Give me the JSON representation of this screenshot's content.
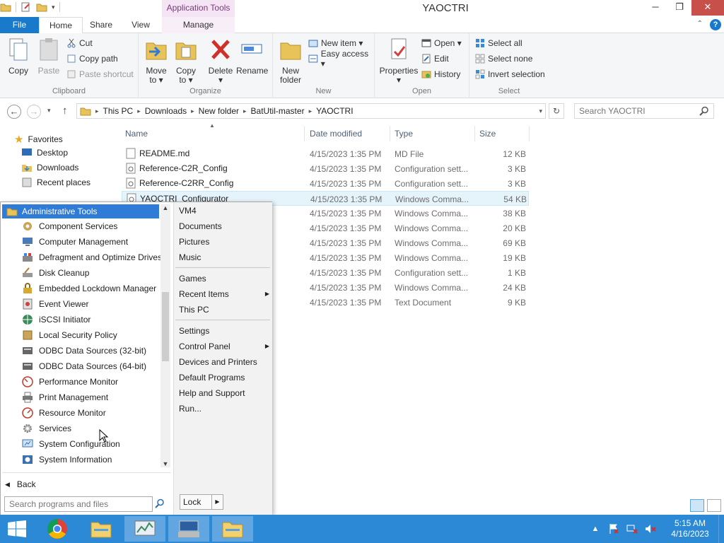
{
  "window": {
    "title": "YAOCTRI",
    "context_tab_title": "Application Tools",
    "controls": {
      "minimize": "─",
      "maximize": "❐",
      "close": "✕"
    }
  },
  "ribbon": {
    "tabs": {
      "file": "File",
      "home": "Home",
      "share": "Share",
      "view": "View",
      "manage": "Manage"
    },
    "groups": {
      "clipboard": {
        "label": "Clipboard",
        "copy": "Copy",
        "paste": "Paste",
        "cut": "Cut",
        "copy_path": "Copy path",
        "paste_shortcut": "Paste shortcut"
      },
      "organize": {
        "label": "Organize",
        "move_to": [
          "Move",
          "to ▾"
        ],
        "copy_to": [
          "Copy",
          "to ▾"
        ],
        "delete": [
          "Delete",
          "▾"
        ],
        "rename": "Rename"
      },
      "new": {
        "label": "New",
        "new_folder": [
          "New",
          "folder"
        ],
        "new_item": "New item ▾",
        "easy_access": "Easy access ▾"
      },
      "open": {
        "label": "Open",
        "properties": [
          "Properties",
          "▾"
        ],
        "open": "Open ▾",
        "edit": "Edit",
        "history": "History"
      },
      "select": {
        "label": "Select",
        "select_all": "Select all",
        "select_none": "Select none",
        "invert": "Invert selection"
      }
    }
  },
  "address": {
    "crumbs": [
      "This PC",
      "Downloads",
      "New folder",
      "BatUtil-master",
      "YAOCTRI"
    ],
    "search_placeholder": "Search YAOCTRI"
  },
  "nav_pane": {
    "favorites": "Favorites",
    "items": [
      "Desktop",
      "Downloads",
      "Recent places"
    ]
  },
  "file_list": {
    "columns": {
      "name": "Name",
      "date": "Date modified",
      "type": "Type",
      "size": "Size"
    },
    "rows": [
      {
        "name": "README.md",
        "date": "4/15/2023 1:35 PM",
        "type": "MD File",
        "size": "12 KB"
      },
      {
        "name": "Reference-C2R_Config",
        "date": "4/15/2023 1:35 PM",
        "type": "Configuration sett...",
        "size": "3 KB"
      },
      {
        "name": "Reference-C2RR_Config",
        "date": "4/15/2023 1:35 PM",
        "type": "Configuration sett...",
        "size": "3 KB"
      },
      {
        "name": "YAOCTRI_Configurator",
        "date": "4/15/2023 1:35 PM",
        "type": "Windows Comma...",
        "size": "54 KB"
      },
      {
        "name": "",
        "date": "4/15/2023 1:35 PM",
        "type": "Windows Comma...",
        "size": "38 KB"
      },
      {
        "name": "",
        "date": "4/15/2023 1:35 PM",
        "type": "Windows Comma...",
        "size": "20 KB"
      },
      {
        "name": "",
        "date": "4/15/2023 1:35 PM",
        "type": "Windows Comma...",
        "size": "69 KB"
      },
      {
        "name": "",
        "date": "4/15/2023 1:35 PM",
        "type": "Windows Comma...",
        "size": "19 KB"
      },
      {
        "name": "",
        "date": "4/15/2023 1:35 PM",
        "type": "Configuration sett...",
        "size": "1 KB"
      },
      {
        "name": "",
        "date": "4/15/2023 1:35 PM",
        "type": "Windows Comma...",
        "size": "24 KB"
      },
      {
        "name": "",
        "date": "4/15/2023 1:35 PM",
        "type": "Text Document",
        "size": "9 KB"
      }
    ]
  },
  "start_menu": {
    "header": "Administrative Tools",
    "items": [
      {
        "label": "Component Services",
        "icon": "component-services-icon"
      },
      {
        "label": "Computer Management",
        "icon": "computer-management-icon"
      },
      {
        "label": "Defragment and Optimize Drives",
        "icon": "defragment-icon"
      },
      {
        "label": "Disk Cleanup",
        "icon": "disk-cleanup-icon"
      },
      {
        "label": "Embedded Lockdown Manager",
        "icon": "lock-icon"
      },
      {
        "label": "Event Viewer",
        "icon": "event-viewer-icon"
      },
      {
        "label": "iSCSI Initiator",
        "icon": "globe-icon"
      },
      {
        "label": "Local Security Policy",
        "icon": "security-policy-icon"
      },
      {
        "label": "ODBC Data Sources (32-bit)",
        "icon": "database-icon"
      },
      {
        "label": "ODBC Data Sources (64-bit)",
        "icon": "database-icon"
      },
      {
        "label": "Performance Monitor",
        "icon": "monitor-icon"
      },
      {
        "label": "Print Management",
        "icon": "printer-icon"
      },
      {
        "label": "Resource Monitor",
        "icon": "monitor-icon"
      },
      {
        "label": "Services",
        "icon": "gear-icon"
      },
      {
        "label": "System Configuration",
        "icon": "system-config-icon"
      },
      {
        "label": "System Information",
        "icon": "info-icon"
      }
    ],
    "back": "Back",
    "search_placeholder": "Search programs and files",
    "right": {
      "group1": [
        "VM4",
        "Documents",
        "Pictures",
        "Music"
      ],
      "group2": [
        "Games",
        "Recent Items",
        "This PC"
      ],
      "group3": [
        "Settings",
        "Control Panel",
        "Devices and Printers",
        "Default Programs",
        "Help and Support",
        "Run..."
      ]
    },
    "lock": "Lock"
  },
  "taskbar": {
    "time": "5:15 AM",
    "date": "4/16/2023"
  },
  "colors": {
    "accent": "#1979ca",
    "taskbar": "#2c89d6",
    "selection": "#2f7cd8"
  }
}
